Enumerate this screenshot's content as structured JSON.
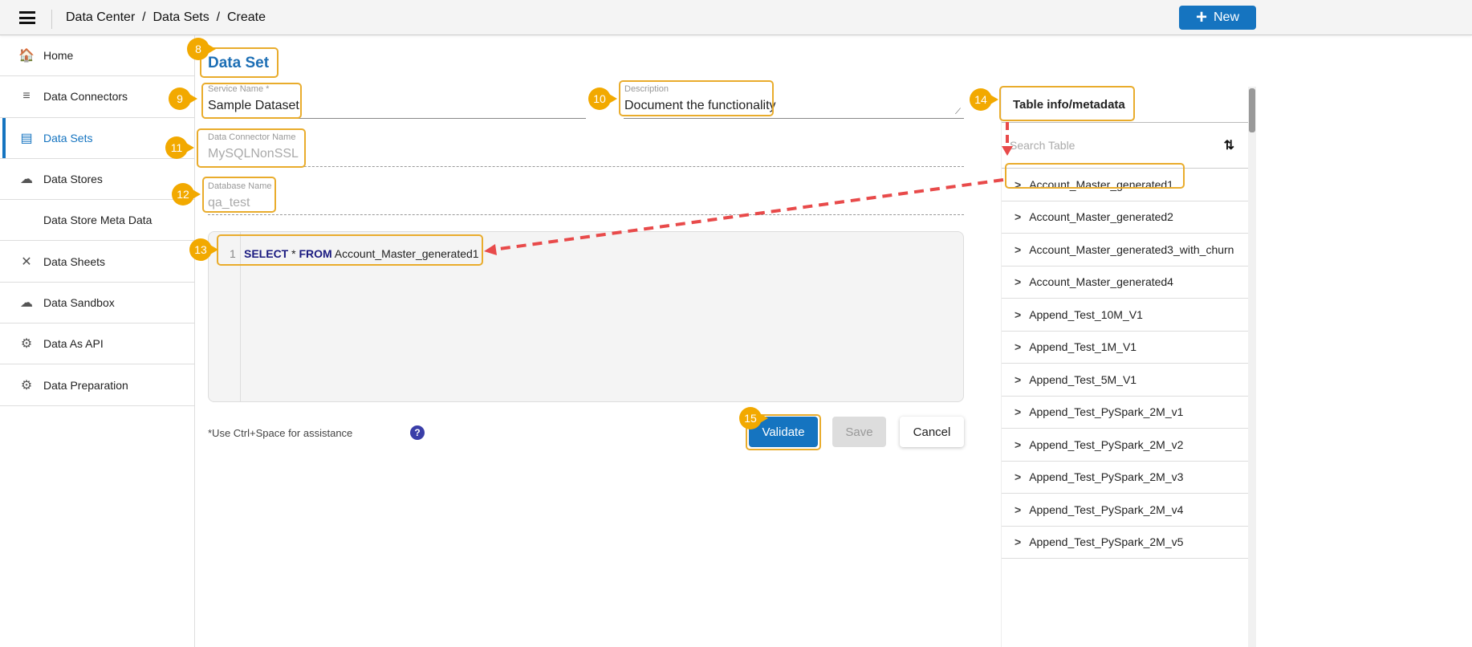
{
  "header": {
    "breadcrumb": "Data Center  /  Data Sets  /  Create",
    "new_label": "New"
  },
  "sidebar": {
    "items": [
      {
        "label": "Home",
        "icon": "home-db-icon"
      },
      {
        "label": "Data Connectors",
        "icon": "database-network-icon"
      },
      {
        "label": "Data Sets",
        "icon": "server-icon",
        "active": true
      },
      {
        "label": "Data Stores",
        "icon": "cloud-db-icon"
      },
      {
        "label": "Data Store Meta Data",
        "icon": "db-code-icon"
      },
      {
        "label": "Data Sheets",
        "icon": "sheets-icon"
      },
      {
        "label": "Data Sandbox",
        "icon": "cloud-icon"
      },
      {
        "label": "Data As API",
        "icon": "api-gear-icon"
      },
      {
        "label": "Data Preparation",
        "icon": "prep-gear-icon"
      }
    ]
  },
  "form": {
    "title": "Data Set",
    "service_name": {
      "label": "Service Name *",
      "value": "Sample Dataset"
    },
    "description": {
      "label": "Description",
      "value": "Document the functionality"
    },
    "connector": {
      "label": "Data Connector Name",
      "value": "MySQLNonSSL"
    },
    "database": {
      "label": "Database Name",
      "value": "qa_test"
    },
    "editor": {
      "line": "1",
      "kw1": "SELECT",
      "star": " * ",
      "kw2": "FROM",
      "table": " Account_Master_generated1"
    },
    "hint": "*Use Ctrl+Space for assistance",
    "help": "?",
    "validate": "Validate",
    "save": "Save",
    "cancel": "Cancel"
  },
  "panel": {
    "title": "Table info/metadata",
    "search_placeholder": "Search Table",
    "tables": [
      "Account_Master_generated1",
      "Account_Master_generated2",
      "Account_Master_generated3_with_churn",
      "Account_Master_generated4",
      "Append_Test_10M_V1",
      "Append_Test_1M_V1",
      "Append_Test_5M_V1",
      "Append_Test_PySpark_2M_v1",
      "Append_Test_PySpark_2M_v2",
      "Append_Test_PySpark_2M_v3",
      "Append_Test_PySpark_2M_v4",
      "Append_Test_PySpark_2M_v5"
    ]
  },
  "annotations": [
    "8",
    "9",
    "10",
    "11",
    "12",
    "13",
    "14",
    "15"
  ],
  "colors": {
    "accent": "#1574c0",
    "annotation": "#f2a900",
    "arrow": "#e84a4a"
  }
}
